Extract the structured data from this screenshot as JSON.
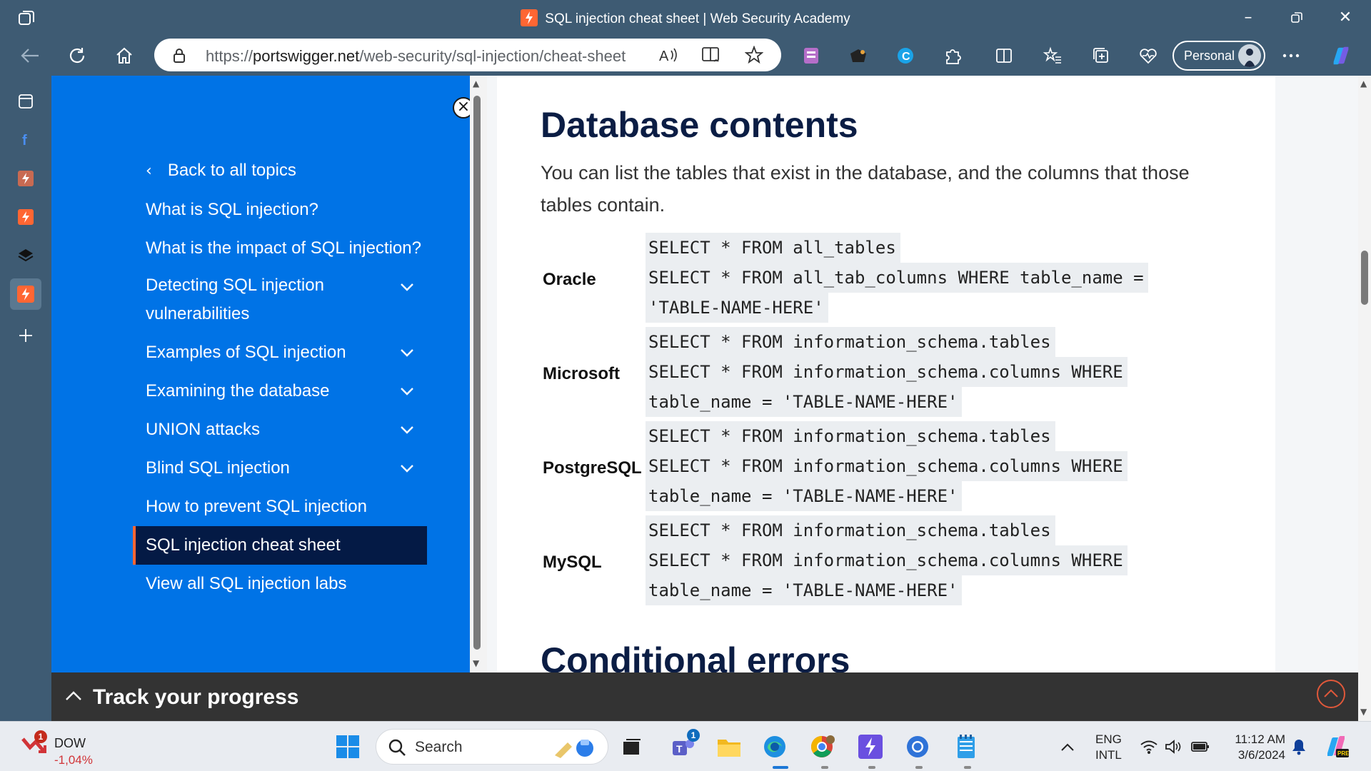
{
  "window": {
    "title": "SQL injection cheat sheet | Web Security Academy"
  },
  "browser": {
    "url_prefix": "https://",
    "url_host": "portswigger.net",
    "url_path": "/web-security/sql-injection/cheat-sheet",
    "profile_label": "Personal"
  },
  "left_nav": {
    "back_label": "Back to all topics",
    "items": [
      {
        "label": "What is SQL injection?",
        "expandable": false
      },
      {
        "label": "What is the impact of SQL injection?",
        "expandable": false
      },
      {
        "label": "Detecting SQL injection",
        "label2": "vulnerabilities",
        "expandable": true
      },
      {
        "label": "Examples of SQL injection",
        "expandable": true
      },
      {
        "label": "Examining the database",
        "expandable": true
      },
      {
        "label": "UNION attacks",
        "expandable": true
      },
      {
        "label": "Blind SQL injection",
        "expandable": true
      },
      {
        "label": "How to prevent SQL injection",
        "expandable": false
      },
      {
        "label": "SQL injection cheat sheet",
        "expandable": false,
        "selected": true
      },
      {
        "label": "View all SQL injection labs",
        "expandable": false
      }
    ]
  },
  "content": {
    "heading": "Database contents",
    "paragraph": "You can list the tables that exist in the database, and the columns that those tables contain.",
    "databases": [
      {
        "name": "Oracle",
        "lines": [
          "SELECT * FROM all_tables",
          "SELECT * FROM all_tab_columns WHERE table_name =",
          "'TABLE-NAME-HERE'"
        ]
      },
      {
        "name": "Microsoft",
        "lines": [
          "SELECT * FROM information_schema.tables",
          "SELECT * FROM information_schema.columns WHERE",
          "table_name = 'TABLE-NAME-HERE'"
        ]
      },
      {
        "name": "PostgreSQL",
        "lines": [
          "SELECT * FROM information_schema.tables",
          "SELECT * FROM information_schema.columns WHERE",
          "table_name = 'TABLE-NAME-HERE'"
        ]
      },
      {
        "name": "MySQL",
        "lines": [
          "SELECT * FROM information_schema.tables",
          "SELECT * FROM information_schema.columns WHERE",
          "table_name = 'TABLE-NAME-HERE'"
        ]
      }
    ],
    "next_heading": "Conditional errors"
  },
  "progress_bar": {
    "label": "Track your progress"
  },
  "taskbar": {
    "stock_name": "DOW",
    "stock_change": "-1,04%",
    "stock_badge": "1",
    "search_label": "Search",
    "teams_badge": "1",
    "lang_line1": "ENG",
    "lang_line2": "INTL",
    "time": "11:12 AM",
    "date": "3/6/2024"
  },
  "colors": {
    "chrome": "#3e5b73",
    "nav_blue": "#0073e6",
    "nav_selected": "#041a45",
    "accent_orange": "#ff6633",
    "heading": "#0b1d44"
  }
}
